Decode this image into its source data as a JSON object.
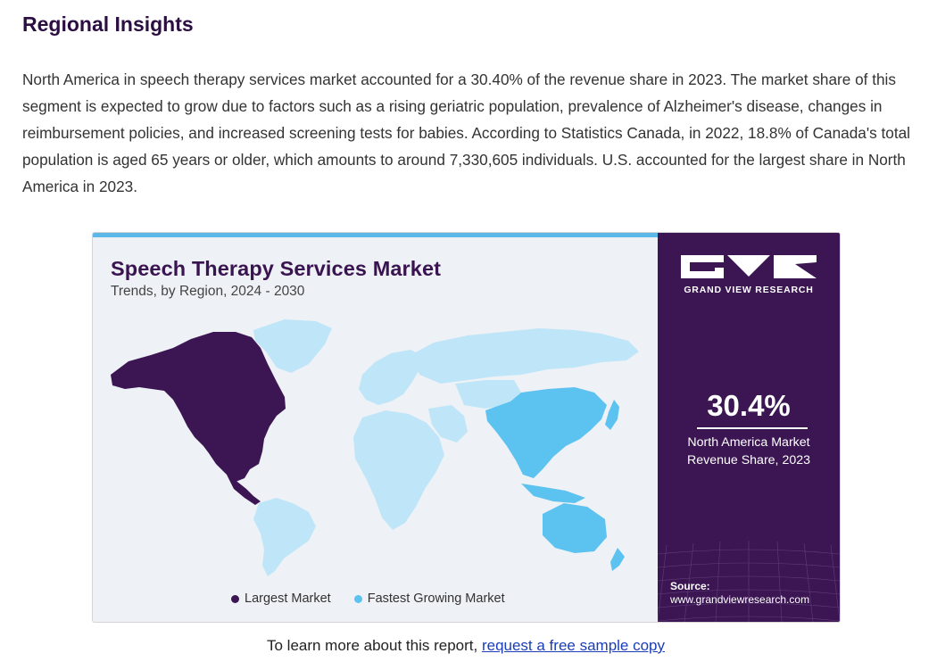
{
  "section": {
    "heading": "Regional Insights",
    "paragraph": "North America in speech therapy services market accounted for a 30.40% of the revenue share in 2023. The market share of this segment is expected to grow due to factors such as a rising geriatric population, prevalence of Alzheimer's disease, changes in reimbursement policies, and increased screening tests for babies. According to Statistics Canada, in 2022, 18.8% of Canada's total population is aged 65 years or older, which amounts to around 7,330,605 individuals. U.S. accounted for the largest share in North America in 2023."
  },
  "infographic": {
    "title": "Speech Therapy Services Market",
    "subtitle": "Trends, by Region, 2024 - 2030",
    "brand": "GRAND VIEW RESEARCH",
    "stat_value": "30.4%",
    "stat_label_line1": "North America Market",
    "stat_label_line2": "Revenue Share, 2023",
    "source_label": "Source:",
    "source_url": "www.grandviewresearch.com",
    "legend": [
      {
        "label": "Largest Market",
        "color": "#3b1652"
      },
      {
        "label": "Fastest Growing Market",
        "color": "#5cc2ef"
      }
    ],
    "colors": {
      "largest": "#3b1652",
      "fastest": "#5cc2ef",
      "other": "#bfe6f8",
      "panel": "#3b1652",
      "accent_bar": "#5bb8e8"
    }
  },
  "cta": {
    "prefix": "To learn more about this report, ",
    "link": "request a free sample copy"
  }
}
